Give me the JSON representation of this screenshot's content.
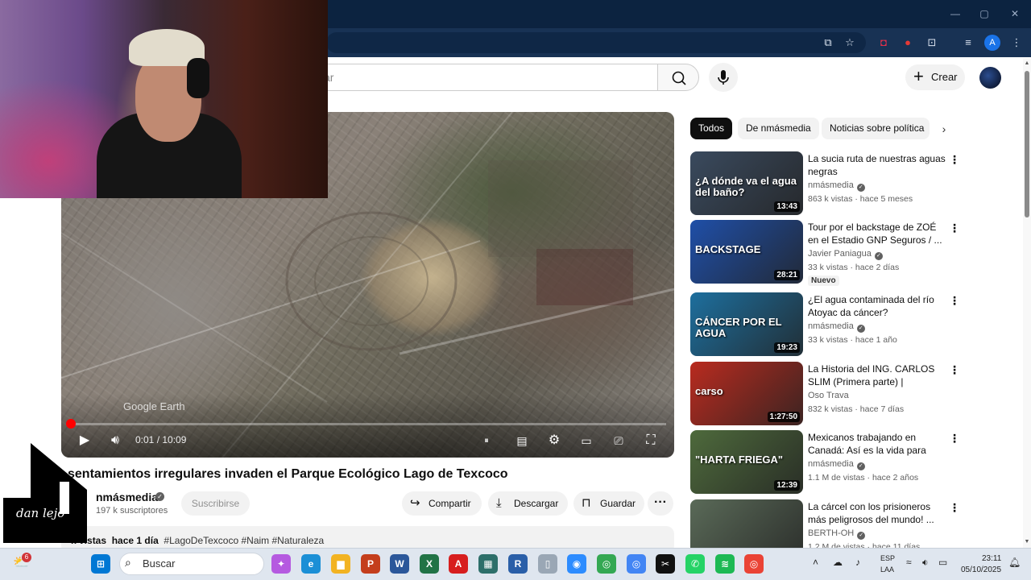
{
  "window": {
    "minimize": "—",
    "maximize": "▢",
    "close": "✕"
  },
  "toolbar_icons": [
    "install-icon",
    "bookmark-star-icon",
    "pocket-icon",
    "extension-red-icon",
    "extensions-icon",
    "media-icon",
    "profile-icon",
    "menu-icon"
  ],
  "toolbar": {
    "profile_letter": "A",
    "star": "☆",
    "menu": "⋮"
  },
  "youtube": {
    "search_placeholder": "car",
    "create_label": "Crear",
    "create_plus": "+"
  },
  "player": {
    "watermark": "Google Earth",
    "current_time": "0:01",
    "duration": "10:09",
    "time_display": "0:01 / 10:09",
    "progress_fraction": 0.002
  },
  "video": {
    "title": "sentamientos irregulares invaden el Parque Ecológico Lago de Texcoco",
    "channel": "nmásmedia",
    "subscribers": "197 k suscriptores",
    "subscribe_label": "Suscribirse",
    "share_label": "Compartir",
    "download_label": "Descargar",
    "save_label": "Guardar",
    "more": "···",
    "views": "k vistas",
    "age": "hace 1 día",
    "hashtags": "#LagoDeTexcoco #Naim #Naturaleza"
  },
  "logo_signature": "dan lejo",
  "chips": [
    "Todos",
    "De nmásmedia",
    "Noticias sobre política"
  ],
  "related": [
    {
      "title": "La sucia ruta de nuestras aguas negras",
      "channel": "nmásmedia",
      "verified": true,
      "meta": "863 k vistas · hace 5 meses",
      "duration": "13:43",
      "thumb_text": "¿A dónde va el agua del baño?",
      "thumb_color": "#3a4a5e"
    },
    {
      "title": "Tour por el backstage de ZOÉ en el Estadio GNP Seguros / ...",
      "channel": "Javier Paniagua",
      "verified": true,
      "meta": "33 k vistas · hace 2 días",
      "duration": "28:21",
      "badge": "Nuevo",
      "thumb_text": "BACKSTAGE",
      "thumb_color": "#1f4fa8"
    },
    {
      "title": "¿El agua contaminada del río Atoyac da cáncer?",
      "channel": "nmásmedia",
      "verified": true,
      "meta": "33 k vistas · hace 1 año",
      "duration": "19:23",
      "thumb_text": "CÁNCER POR EL AGUA",
      "thumb_color": "#1d6f9e"
    },
    {
      "title": "La Historia del ING. CARLOS SLIM (Primera parte) | CRACK...",
      "channel": "Oso Trava",
      "verified": false,
      "meta": "832 k vistas · hace 7 días",
      "duration": "1:27:50",
      "thumb_text": "carso",
      "thumb_color": "#b92b1f"
    },
    {
      "title": "Mexicanos trabajando en Canadá: Así es la vida para los...",
      "channel": "nmásmedia",
      "verified": true,
      "meta": "1.1 M de vistas · hace 2 años",
      "duration": "12:39",
      "thumb_text": "\"HARTA FRIEGA\"",
      "thumb_color": "#4e6a3c"
    },
    {
      "title": "La cárcel con los prisioneros más peligrosos del mundo! ...",
      "channel": "BERTH-OH",
      "verified": true,
      "meta": "1.2 M de vistas · hace 11 días",
      "duration": "",
      "thumb_text": "",
      "thumb_color": "#5a6a58"
    }
  ],
  "taskbar": {
    "weather_badge": "6",
    "search_label": "Buscar",
    "apps": [
      {
        "name": "start-icon",
        "glyph": "⊞",
        "color": "#0078d4"
      },
      {
        "name": "copilot-icon",
        "glyph": "✦",
        "color": "#b55ae0"
      },
      {
        "name": "edge-icon",
        "glyph": "e",
        "color": "#1b8fd6"
      },
      {
        "name": "file-explorer-icon",
        "glyph": "▆",
        "color": "#f2b322"
      },
      {
        "name": "powerpoint-icon",
        "glyph": "P",
        "color": "#c43e1c"
      },
      {
        "name": "word-icon",
        "glyph": "W",
        "color": "#2b579a"
      },
      {
        "name": "excel-icon",
        "glyph": "X",
        "color": "#217346"
      },
      {
        "name": "acrobat-icon",
        "glyph": "A",
        "color": "#d71e1e"
      },
      {
        "name": "sheets-app-icon",
        "glyph": "▦",
        "color": "#2d6f6a"
      },
      {
        "name": "r-app-icon",
        "glyph": "R",
        "color": "#2a5fa8"
      },
      {
        "name": "document-icon",
        "glyph": "▯",
        "color": "#9aa7b5"
      },
      {
        "name": "zoom-icon",
        "glyph": "◉",
        "color": "#2d8cff"
      },
      {
        "name": "chrome-icon",
        "glyph": "◎",
        "color": "#34a853"
      },
      {
        "name": "chrome-profile-icon",
        "glyph": "◎",
        "color": "#4285f4"
      },
      {
        "name": "capcut-icon",
        "glyph": "✂",
        "color": "#111111"
      },
      {
        "name": "whatsapp-icon",
        "glyph": "✆",
        "color": "#25d366"
      },
      {
        "name": "spotify-icon",
        "glyph": "≋",
        "color": "#1db954"
      },
      {
        "name": "chrome-alt-icon",
        "glyph": "◎",
        "color": "#ea4335"
      }
    ],
    "lang1": "ESP",
    "lang2": "LAA",
    "time": "23:11",
    "date": "05/10/2025"
  }
}
